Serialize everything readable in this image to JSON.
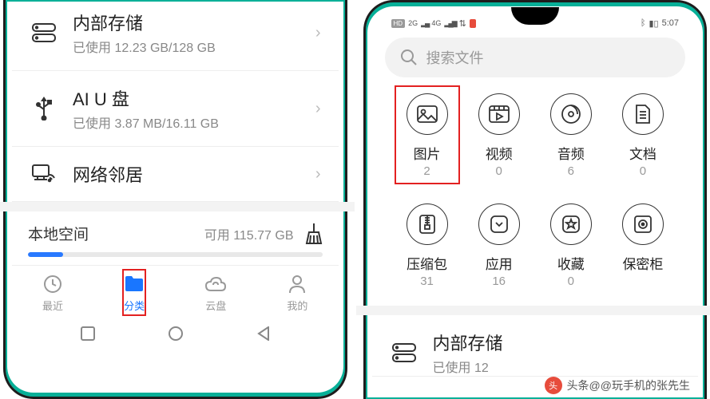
{
  "left": {
    "storage_rows": [
      {
        "id": "internal",
        "title": "内部存储",
        "sub_prefix": "已使用 ",
        "usage": "12.23 GB/128 GB"
      },
      {
        "id": "usb",
        "title": "AI U 盘",
        "sub_prefix": "已使用 ",
        "usage": "3.87 MB/16.11 GB"
      },
      {
        "id": "network",
        "title": "网络邻居",
        "sub_prefix": "",
        "usage": ""
      }
    ],
    "local_space": {
      "title": "本地空间",
      "free_prefix": "可用 ",
      "free": "115.77 GB"
    },
    "tabs": [
      {
        "id": "recent",
        "label": "最近"
      },
      {
        "id": "category",
        "label": "分类"
      },
      {
        "id": "cloud",
        "label": "云盘"
      },
      {
        "id": "me",
        "label": "我的"
      }
    ]
  },
  "right": {
    "time": "5:07",
    "search_placeholder": "搜索文件",
    "categories": [
      {
        "id": "images",
        "label": "图片",
        "count": "2",
        "highlight": true
      },
      {
        "id": "videos",
        "label": "视频",
        "count": "0"
      },
      {
        "id": "audio",
        "label": "音频",
        "count": "6"
      },
      {
        "id": "docs",
        "label": "文档",
        "count": "0"
      },
      {
        "id": "archives",
        "label": "压缩包",
        "count": "31"
      },
      {
        "id": "apps",
        "label": "应用",
        "count": "16"
      },
      {
        "id": "favorites",
        "label": "收藏",
        "count": "0"
      },
      {
        "id": "safe",
        "label": "保密柜",
        "count": ""
      }
    ],
    "storage_row": {
      "title": "内部存储",
      "sub_prefix": "已使用 ",
      "usage": "12"
    }
  },
  "watermark": "头条@@玩手机的张先生"
}
